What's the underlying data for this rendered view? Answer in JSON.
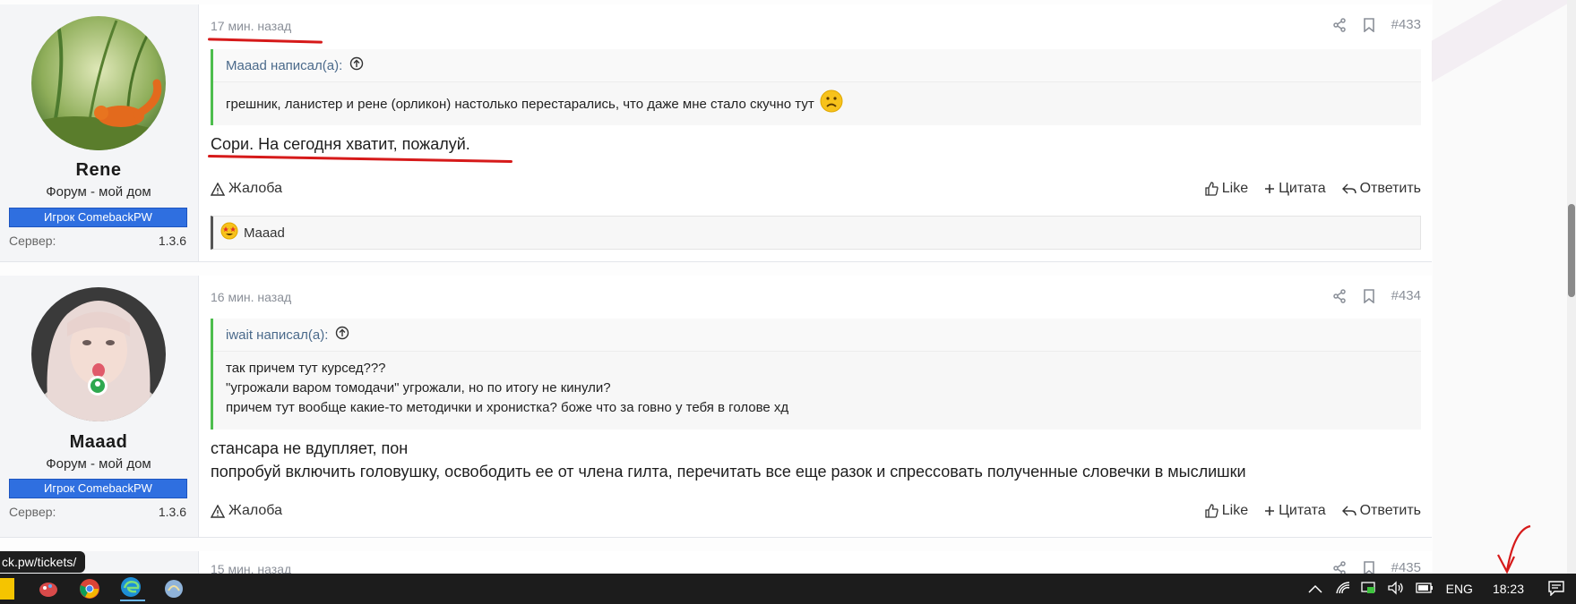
{
  "posts": [
    {
      "date": "17 мин. назад",
      "number": "#433",
      "username": "Rene",
      "user_title": "Форум - мой дом",
      "banner": "Игрок ComebackPW",
      "server_label": "Сервер:",
      "server_value": "1.3.6",
      "quote_author": "Maaad написал(а):",
      "quote_lines": [
        "грешник, ланистер и рене (орликон) настолько перестарались, что даже мне стало скучно тут"
      ],
      "message_lines": [
        "Сори. На сегодня хватит, пожалуй."
      ],
      "report_label": "Жалоба",
      "like_label": "Like",
      "quote_label": "Цитата",
      "reply_label": "Ответить",
      "reaction_user": "Maaad"
    },
    {
      "date": "16 мин. назад",
      "number": "#434",
      "username": "Maaad",
      "user_title": "Форум - мой дом",
      "banner": "Игрок ComebackPW",
      "server_label": "Сервер:",
      "server_value": "1.3.6",
      "quote_author": "iwait написал(а):",
      "quote_lines": [
        "так причем тут курсед???",
        "\"угрожали варом томодачи\" угрожали, но по итогу не кинули?",
        "причем тут вообще какие-то методички и хронистка? боже что за говно у тебя в голове хд"
      ],
      "message_lines": [
        "стансара не вдупляет, пон",
        "попробуй включить головушку, освободить ее от члена гилта, перечитать все еще разок и спрессовать полученные словечки в мыслишки"
      ],
      "report_label": "Жалоба",
      "like_label": "Like",
      "quote_label": "Цитата",
      "reply_label": "Ответить"
    },
    {
      "date": "15 мин. назад",
      "number": "#435"
    }
  ],
  "status_url": "ck.pw/tickets/",
  "taskbar": {
    "lang": "ENG",
    "time": "18:23"
  },
  "colors": {
    "banner": "#2f6fe0",
    "quote_border": "#4dbd4d",
    "annotation_red": "#d61a1a",
    "meta_gray": "#8a8f98"
  },
  "icons": [
    "share-icon",
    "bookmark-icon",
    "arrow-up-circle-icon",
    "warning-icon",
    "thumbs-up-icon",
    "plus-icon",
    "reply-icon",
    "star-eyes-emoji-icon",
    "frown-emoji-icon",
    "online-icon"
  ]
}
